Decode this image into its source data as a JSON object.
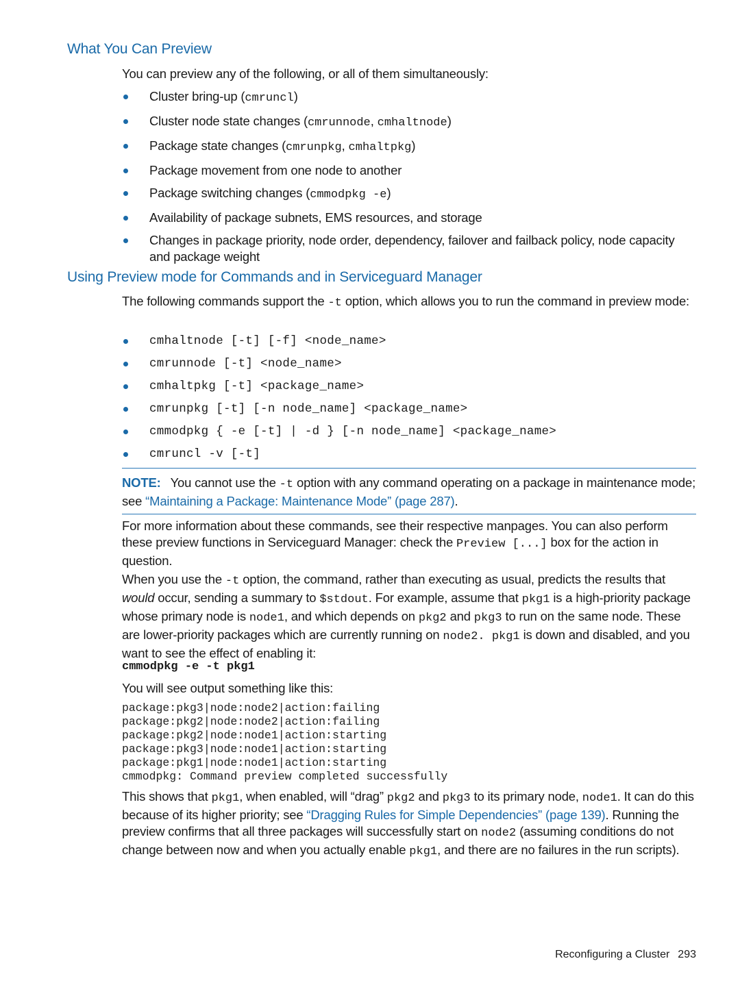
{
  "section1": {
    "heading": "What You Can Preview",
    "intro": "You can preview any of the following, or all of them simultaneously:",
    "items": [
      {
        "text": "Cluster bring-up (",
        "code": "cmruncl",
        "tail": ")"
      },
      {
        "text": "Cluster node state changes (",
        "code": "cmrunnode",
        "mid": ", ",
        "code2": "cmhaltnode",
        "tail": ")"
      },
      {
        "text": "Package state changes (",
        "code": "cmrunpkg",
        "mid": ", ",
        "code2": "cmhaltpkg",
        "tail": ")"
      },
      {
        "text": "Package movement from one node to another"
      },
      {
        "text": "Package switching changes (",
        "code": "cmmodpkg -e",
        "tail": ")"
      },
      {
        "text": "Availability of package subnets, EMS resources, and storage"
      },
      {
        "text": "Changes in package priority, node order, dependency, failover and failback policy, node capacity and package weight"
      }
    ]
  },
  "section2": {
    "heading": "Using Preview mode for Commands and in Serviceguard Manager",
    "intro_a": "The following commands support the ",
    "intro_code": "-t",
    "intro_b": " option, which allows you to run the command in preview mode:",
    "commands": [
      "cmhaltnode [-t] [-f] <node_name>",
      "cmrunnode [-t] <node_name>",
      "cmhaltpkg [-t] <package_name>",
      "cmrunpkg [-t] [-n node_name] <package_name>",
      "cmmodpkg { -e [-t] | -d } [-n node_name] <package_name>",
      "cmruncl -v [-t]"
    ],
    "note": {
      "label": "NOTE:",
      "text_a": "You cannot use the ",
      "code": "-t",
      "text_b": " option with any command operating on a package in maintenance mode; see ",
      "link": "“Maintaining a Package: Maintenance Mode” (page 287)",
      "text_c": "."
    },
    "para1": {
      "a": "For more information about these commands, see their respective manpages. You can also perform these preview functions in Serviceguard Manager: check the ",
      "code": "Preview [...]",
      "b": " box for the action in question."
    },
    "para2": {
      "a": "When you use the ",
      "c1": "-t",
      "b": " option, the command, rather than executing as usual, predicts the results that ",
      "em": "would",
      "c": " occur, sending a summary to ",
      "c2": "$stdout",
      "d": ". For example, assume that ",
      "c3": "pkg1",
      "e": " is a high-priority package whose primary node is ",
      "c4": "node1",
      "f": ", and which depends on ",
      "c5": "pkg2",
      "g": " and ",
      "c6": "pkg3",
      "h": " to run on the same node. These are lower-priority packages which are currently running on ",
      "c7": "node2. pkg1",
      "i": " is down and disabled, and you want to see the effect of enabling it:"
    },
    "example_command": "cmmodpkg -e -t pkg1",
    "output_intro": "You will see output something like this:",
    "output_lines": [
      "package:pkg3|node:node2|action:failing",
      "package:pkg2|node:node2|action:failing",
      "package:pkg2|node:node1|action:starting",
      "package:pkg3|node:node1|action:starting",
      "package:pkg1|node:node1|action:starting",
      "cmmodpkg: Command preview completed successfully"
    ],
    "para3": {
      "a": "This shows that ",
      "c1": "pkg1",
      "b": ", when enabled, will “drag” ",
      "c2": "pkg2",
      "c": " and ",
      "c3": "pkg3",
      "d": " to its primary node, ",
      "c4": "node1",
      "e": ". It can do this because of its higher priority; see ",
      "link": "“Dragging Rules for Simple Dependencies” (page 139)",
      "f": ". Running the preview confirms that all three packages will successfully start on ",
      "c5": "node2",
      "g": " (assuming conditions do not change between now and when you actually enable ",
      "c6": "pkg1",
      "h": ", and there are no failures in the run scripts)."
    }
  },
  "footer": {
    "chapter": "Reconfiguring a Cluster",
    "page": "293"
  }
}
